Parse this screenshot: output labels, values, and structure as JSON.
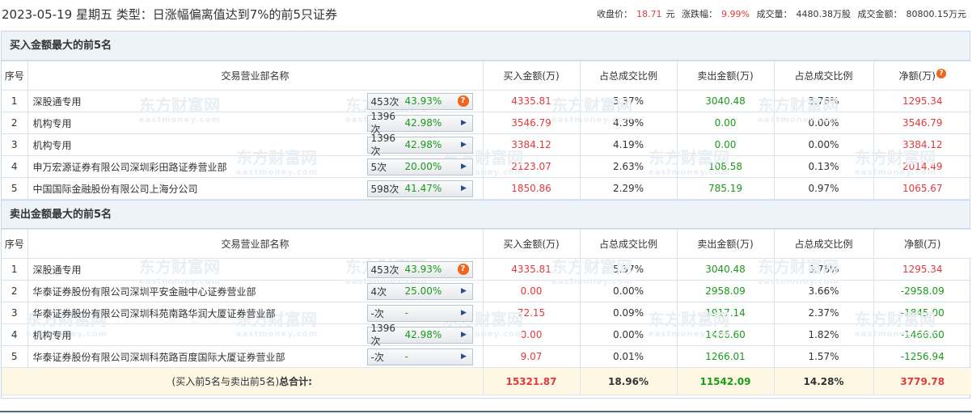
{
  "header": {
    "title": "2023-05-19 星期五 类型：日涨幅偏离值达到7%的前5只证券",
    "close_label": "收盘价：",
    "close_value": "18.71",
    "close_unit": "元",
    "change_label": "涨跌幅：",
    "change_value": "9.99%",
    "volume_label": "成交量：",
    "volume_value": "4480.38万股",
    "amount_label": "成交金额：",
    "amount_value": "80800.15万元"
  },
  "columns": {
    "idx": "序号",
    "name": "交易营业部名称",
    "buy": "买入金额(万)",
    "buy_ratio": "占总成交比例",
    "sell": "卖出金额(万)",
    "sell_ratio": "占总成交比例",
    "net": "净额(万)"
  },
  "buy_section": {
    "title": "买入金额最大的前5名",
    "rows": [
      {
        "idx": "1",
        "name": "深股通专用",
        "times": "453次",
        "win": "43.93%",
        "btn": "hint",
        "buy": "4335.81",
        "buy_ratio": "5.37%",
        "sell": "3040.48",
        "sell_ratio": "3.76%",
        "net": "1295.34",
        "net_color": "red"
      },
      {
        "idx": "2",
        "name": "机构专用",
        "times": "1396次",
        "win": "42.98%",
        "btn": "arrow",
        "buy": "3546.79",
        "buy_ratio": "4.39%",
        "sell": "0.00",
        "sell_ratio": "0.00%",
        "net": "3546.79",
        "net_color": "red"
      },
      {
        "idx": "3",
        "name": "机构专用",
        "times": "1396次",
        "win": "42.98%",
        "btn": "arrow",
        "buy": "3384.12",
        "buy_ratio": "4.19%",
        "sell": "0.00",
        "sell_ratio": "0.00%",
        "net": "3384.12",
        "net_color": "red"
      },
      {
        "idx": "4",
        "name": "申万宏源证券有限公司深圳彩田路证券营业部",
        "times": "5次",
        "win": "20.00%",
        "btn": "arrow",
        "buy": "2123.07",
        "buy_ratio": "2.63%",
        "sell": "108.58",
        "sell_ratio": "0.13%",
        "net": "2014.49",
        "net_color": "red"
      },
      {
        "idx": "5",
        "name": "中国国际金融股份有限公司上海分公司",
        "times": "598次",
        "win": "41.47%",
        "btn": "arrow",
        "buy": "1850.86",
        "buy_ratio": "2.29%",
        "sell": "785.19",
        "sell_ratio": "0.97%",
        "net": "1065.67",
        "net_color": "red"
      }
    ]
  },
  "sell_section": {
    "title": "卖出金额最大的前5名",
    "rows": [
      {
        "idx": "1",
        "name": "深股通专用",
        "times": "453次",
        "win": "43.93%",
        "btn": "hint",
        "buy": "4335.81",
        "buy_ratio": "5.37%",
        "sell": "3040.48",
        "sell_ratio": "3.76%",
        "net": "1295.34",
        "net_color": "red"
      },
      {
        "idx": "2",
        "name": "华泰证券股份有限公司深圳平安金融中心证券营业部",
        "times": "4次",
        "win": "25.00%",
        "btn": "arrow",
        "buy": "0.00",
        "buy_ratio": "0.00%",
        "sell": "2958.09",
        "sell_ratio": "3.66%",
        "net": "-2958.09",
        "net_color": "green"
      },
      {
        "idx": "3",
        "name": "华泰证券股份有限公司深圳科苑南路华润大厦证券营业部",
        "times": "-次",
        "win": "-",
        "btn": "arrow",
        "buy": "72.15",
        "buy_ratio": "0.09%",
        "sell": "1917.14",
        "sell_ratio": "2.37%",
        "net": "-1845.00",
        "net_color": "green"
      },
      {
        "idx": "4",
        "name": "机构专用",
        "times": "1396次",
        "win": "42.98%",
        "btn": "arrow",
        "buy": "0.00",
        "buy_ratio": "0.00%",
        "sell": "1466.60",
        "sell_ratio": "1.82%",
        "net": "-1466.60",
        "net_color": "green"
      },
      {
        "idx": "5",
        "name": "华泰证券股份有限公司深圳科苑路百度国际大厦证券营业部",
        "times": "-次",
        "win": "-",
        "btn": "arrow",
        "buy": "9.07",
        "buy_ratio": "0.01%",
        "sell": "1266.01",
        "sell_ratio": "1.57%",
        "net": "-1256.94",
        "net_color": "green"
      }
    ]
  },
  "total": {
    "label_prefix": "(买入前5名与卖出前5名)",
    "label_bold": "总合计:",
    "buy": "15321.87",
    "buy_ratio": "18.96%",
    "sell": "11542.09",
    "sell_ratio": "14.28%",
    "net": "3779.78"
  },
  "watermark": {
    "cn": "东方财富网",
    "en": "eastmoney.com"
  },
  "icons": {
    "hint": "question-icon",
    "arrow": "play-arrow-icon"
  },
  "colors": {
    "up": "#e4393c",
    "down": "#1a9b1a",
    "section_bg": "#eef3f8",
    "total_bg": "#fdf7e3"
  }
}
